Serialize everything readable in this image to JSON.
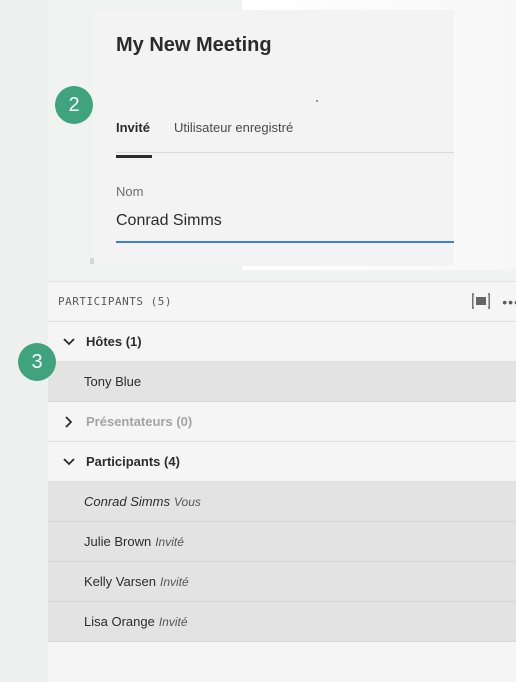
{
  "meeting": {
    "title": "My New Meeting",
    "tabs": [
      {
        "label": "Invité",
        "active": true
      },
      {
        "label": "Utilisateur enregistré",
        "active": false
      }
    ],
    "name_label": "Nom",
    "name_value": "Conrad Simms"
  },
  "badges": [
    "2",
    "3"
  ],
  "participants_panel": {
    "title": "PARTICIPANTS  (5)",
    "icons": [
      "expand-icon",
      "more-icon"
    ],
    "groups": [
      {
        "label": "Hôtes (1)",
        "expanded": true,
        "users": [
          {
            "name": "Tony Blue",
            "role": ""
          }
        ]
      },
      {
        "label": "Présentateurs (0)",
        "expanded": false,
        "users": []
      },
      {
        "label": "Participants (4)",
        "expanded": true,
        "users": [
          {
            "name": "Conrad Simms",
            "role": "Vous"
          },
          {
            "name": "Julie Brown",
            "role": "Invité"
          },
          {
            "name": "Kelly Varsen",
            "role": "Invité"
          },
          {
            "name": "Lisa Orange",
            "role": "Invité"
          }
        ]
      }
    ]
  },
  "colors": {
    "accent_blue": "#3a82d6",
    "badge_green": "#3fa37d"
  }
}
